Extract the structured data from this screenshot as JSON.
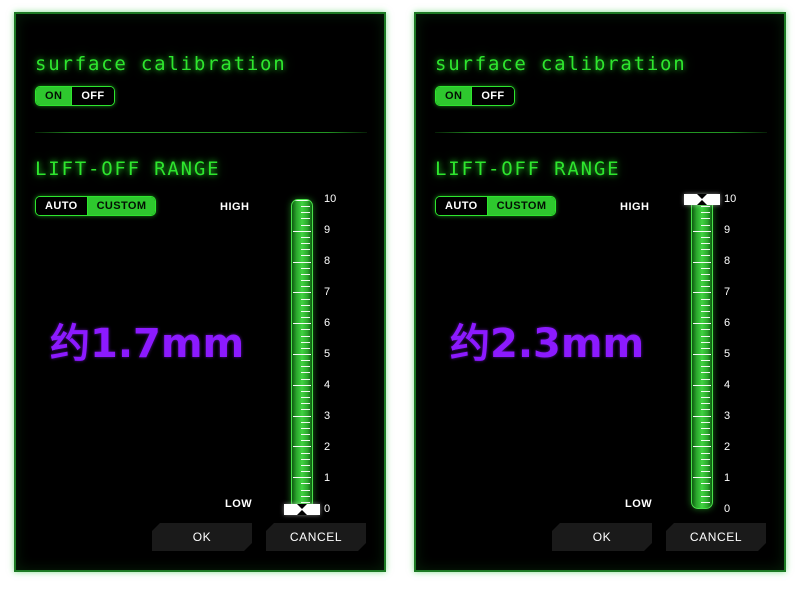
{
  "panels": [
    {
      "id": "left",
      "surface_heading": "surface calibration",
      "surface_toggle": {
        "options": [
          "ON",
          "OFF"
        ],
        "selected": "ON"
      },
      "liftoff_heading": "LIFT-OFF RANGE",
      "liftoff_toggle": {
        "options": [
          "AUTO",
          "CUSTOM"
        ],
        "selected": "CUSTOM"
      },
      "measurement": "约1.7mm",
      "slider": {
        "high_label": "HIGH",
        "low_label": "LOW",
        "min": 0,
        "max": 10,
        "value": 0,
        "tick_labels": [
          "10",
          "9",
          "8",
          "7",
          "6",
          "5",
          "4",
          "3",
          "2",
          "1",
          "0"
        ]
      },
      "buttons": {
        "ok": "OK",
        "cancel": "CANCEL"
      }
    },
    {
      "id": "right",
      "surface_heading": "surface calibration",
      "surface_toggle": {
        "options": [
          "ON",
          "OFF"
        ],
        "selected": "ON"
      },
      "liftoff_heading": "LIFT-OFF RANGE",
      "liftoff_toggle": {
        "options": [
          "AUTO",
          "CUSTOM"
        ],
        "selected": "CUSTOM"
      },
      "measurement": "约2.3mm",
      "slider": {
        "high_label": "HIGH",
        "low_label": "LOW",
        "min": 0,
        "max": 10,
        "value": 10,
        "tick_labels": [
          "10",
          "9",
          "8",
          "7",
          "6",
          "5",
          "4",
          "3",
          "2",
          "1",
          "0"
        ]
      },
      "buttons": {
        "ok": "OK",
        "cancel": "CANCEL"
      }
    }
  ],
  "colors": {
    "accent_green": "#2ee62e",
    "toggle_active": "#2ec82e",
    "panel_bg": "#000000",
    "annotation_purple": "#8c1aff",
    "button_bg": "#1a1a1a",
    "page_bg": "#ffffff"
  }
}
